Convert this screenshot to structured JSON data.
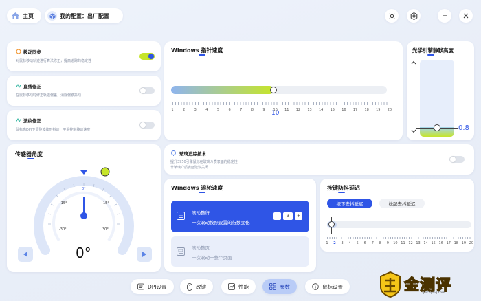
{
  "topbar": {
    "home_label": "主页",
    "profile_label": "我的配置：出厂配置"
  },
  "motion_sync": {
    "title": "移动同步",
    "desc": "对鼠标移动轨迹进行算法修正，提高追踪的稳定性",
    "on": true
  },
  "angle_snap": {
    "title": "直线修正",
    "desc": "在鼠标移动时修正轨迹偏差，消除偏移抖动",
    "on": false
  },
  "ripple": {
    "title": "波纹修正",
    "desc": "鼠标高DPI下调整波纹形抖动，平滑控制移动速度",
    "on": false
  },
  "pointer_speed": {
    "title": "Windows 指针速度",
    "value": "10",
    "fraction": 0.45,
    "ticks": [
      "1",
      "2",
      "3",
      "4",
      "5",
      "6",
      "7",
      "8",
      "9",
      "10",
      "11",
      "12",
      "13",
      "14",
      "15",
      "16",
      "17",
      "18",
      "19",
      "20"
    ]
  },
  "optical_lod": {
    "title": "光学引擎静默高度",
    "value": "0.8"
  },
  "sensor_angle": {
    "title": "传感器角度",
    "value": "0°",
    "scale": {
      "top": "0°",
      "l15": "-15°",
      "r15": "15°",
      "l30": "-30°",
      "r30": "30°"
    }
  },
  "glass_tracking": {
    "title": "玻璃追踪技术",
    "desc1": "提升3950引擎鼠标在玻璃介质表面的稳定性",
    "desc2": "非玻璃介质表面建议关闭",
    "on": false
  },
  "scroll_speed": {
    "title": "Windows 滚轮速度",
    "option1_title": "滚动整行",
    "option1_desc": "一次滚动按照设置的行数变化",
    "option1_value": "3",
    "minus": "-",
    "plus": "+",
    "option2_title": "滚动整页",
    "option2_desc": "一次滚动一整个页面"
  },
  "debounce": {
    "title": "按键防抖延迟",
    "tab_press": "按下去抖延迟",
    "tab_release": "松起去抖延迟",
    "ticks": [
      "1",
      "2",
      "3",
      "4",
      "5",
      "6",
      "7",
      "8",
      "9",
      "10",
      "11",
      "12",
      "13",
      "14",
      "15",
      "16",
      "17",
      "18",
      "19",
      "20"
    ],
    "selected": "2"
  },
  "bottom_nav": [
    {
      "label": "DPI设置"
    },
    {
      "label": "改键"
    },
    {
      "label": "性能"
    },
    {
      "label": "参数"
    },
    {
      "label": "鼠标设置"
    }
  ],
  "watermark": {
    "text": "金测评",
    "sub": "jinceping.com"
  },
  "colors": {
    "accent": "#2f55e6",
    "lime": "#c6e52a",
    "active_nav": "#b9ccf7"
  }
}
